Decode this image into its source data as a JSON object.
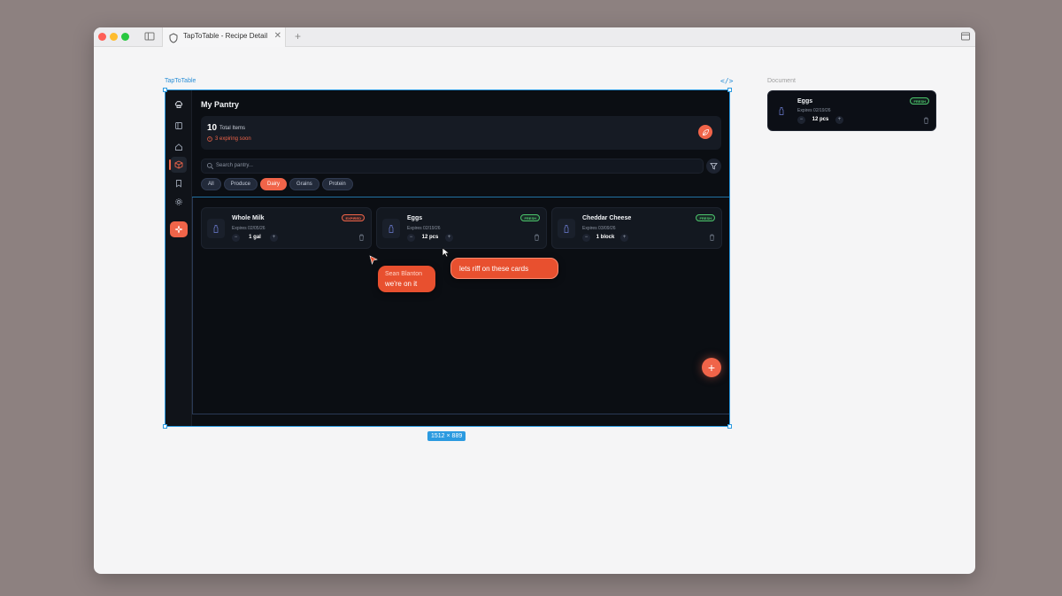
{
  "browser": {
    "tab_title": "TapToTable - Recipe Detail",
    "close_glyph": "✕",
    "add_glyph": "+"
  },
  "canvas": {
    "frame_label": "TapToTable",
    "code_glyph": "</>",
    "doc_label": "Document",
    "frame_size": "1512 × 889"
  },
  "app": {
    "page_title": "My Pantry",
    "summary": {
      "count": "10",
      "count_label": "Total Items",
      "warning": "3 expiring soon"
    },
    "search": {
      "placeholder": "Search pantry..."
    },
    "filters": [
      {
        "label": "All",
        "active": false
      },
      {
        "label": "Produce",
        "active": false
      },
      {
        "label": "Dairy",
        "active": true
      },
      {
        "label": "Grains",
        "active": false
      },
      {
        "label": "Protein",
        "active": false
      }
    ],
    "cards": [
      {
        "name": "Whole Milk",
        "expires": "Expires 02/05/26",
        "qty": "1 gal",
        "badge": "EXPIRED",
        "status": "expired"
      },
      {
        "name": "Eggs",
        "expires": "Expires 02/19/26",
        "qty": "12 pcs",
        "badge": "FRESH",
        "status": "fresh"
      },
      {
        "name": "Cheddar Cheese",
        "expires": "Expires 03/09/26",
        "qty": "1 block",
        "badge": "FRESH",
        "status": "fresh"
      }
    ],
    "stepper": {
      "minus": "−",
      "plus": "+"
    },
    "fab_label": "+"
  },
  "collab": {
    "user_name": "Sean Blanton",
    "user_message": "we're on it",
    "comment": "lets riff on these cards"
  },
  "document_card": {
    "name": "Eggs",
    "expires": "Expires 02/19/26",
    "qty": "12 pcs",
    "badge": "FRESH"
  },
  "colors": {
    "accent": "#f06449",
    "selection": "#2b9ae0",
    "fresh": "#4cc66c",
    "background": "#0b0e13"
  },
  "icons": [
    "sidebar-toggle-icon",
    "home-icon",
    "box-icon",
    "bookmark-icon",
    "gear-icon",
    "sparkle-icon",
    "search-icon",
    "filter-icon",
    "trash-icon",
    "bottle-icon"
  ]
}
